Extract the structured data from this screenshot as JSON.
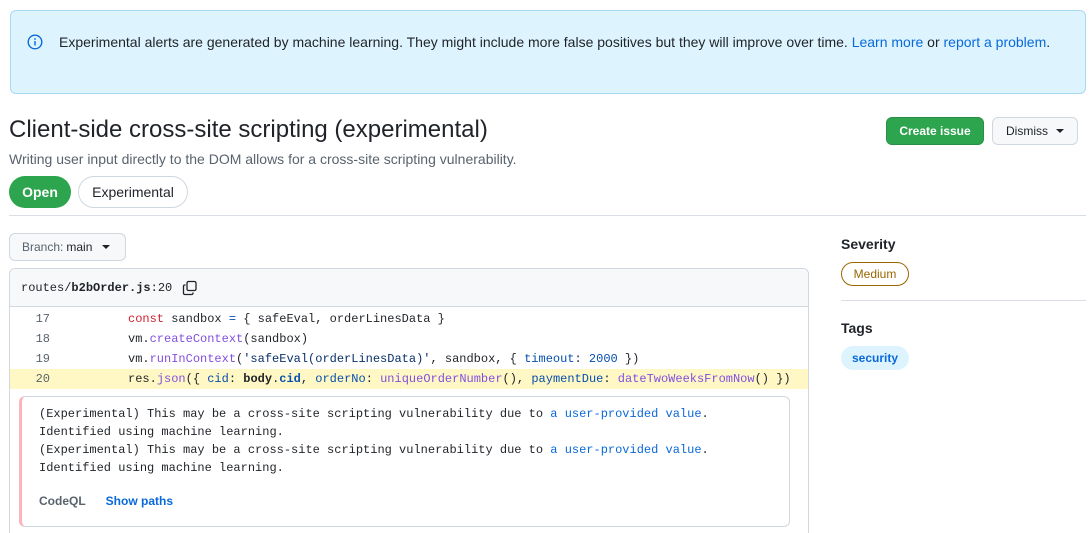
{
  "banner": {
    "text": "Experimental alerts are generated by machine learning. They might include more false positives but they will improve over time.",
    "learn_more": "Learn more",
    "or": "or",
    "report_problem": "report a problem",
    "icon": "info-icon",
    "accent_color": "#0969da"
  },
  "alert": {
    "title": "Client-side cross-site scripting (experimental)",
    "subtitle": "Writing user input directly to the DOM allows for a cross-site scripting vulnerability.",
    "state": "Open",
    "label": "Experimental"
  },
  "actions": {
    "create_issue": "Create issue",
    "dismiss": "Dismiss"
  },
  "branch": {
    "label": "Branch:",
    "value": "main"
  },
  "code": {
    "file_prefix": "routes/",
    "file_name": "b2bOrder.js",
    "file_line": ":20",
    "copy_icon": "copy-icon",
    "lines": [
      {
        "num": "17"
      },
      {
        "num": "18"
      },
      {
        "num": "19"
      },
      {
        "num": "20"
      }
    ],
    "highlight_color": "#fff8c5"
  },
  "message": {
    "part1": "(Experimental) This may be a cross-site scripting vulnerability due to",
    "link": "a user-provided value",
    "part2": "Identified using machine learning.",
    "tool": "CodeQL",
    "show_paths": "Show paths"
  },
  "sidebar": {
    "severity_heading": "Severity",
    "severity_value": "Medium",
    "tags_heading": "Tags",
    "tag": "security",
    "severity_color": "#9a6700"
  }
}
